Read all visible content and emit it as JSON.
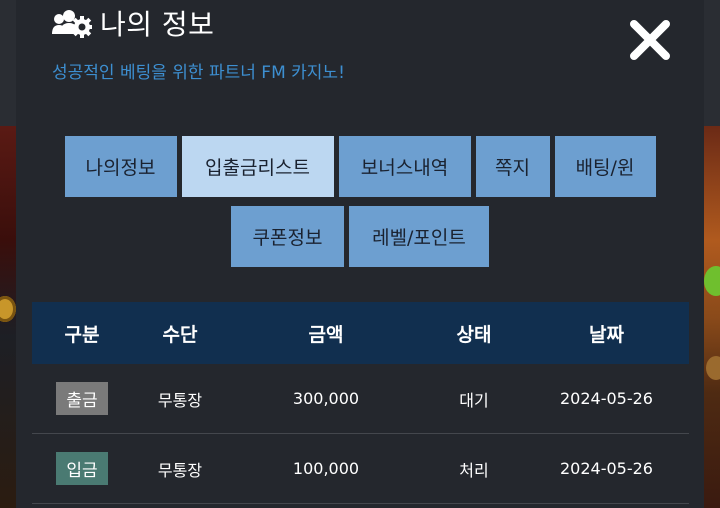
{
  "header": {
    "title": "나의 정보",
    "title_icon": "users-gear-icon",
    "subtitle": "성공적인 베팅을 위한 파트너 FM 카지노!",
    "close_icon": "close-icon"
  },
  "tabs": {
    "row1": [
      {
        "label": "나의정보",
        "active": false
      },
      {
        "label": "입출금리스트",
        "active": true
      },
      {
        "label": "보너스내역",
        "active": false
      },
      {
        "label": "쪽지",
        "active": false
      },
      {
        "label": "배팅/윈",
        "active": false
      }
    ],
    "row2": [
      {
        "label": "쿠폰정보",
        "active": false
      },
      {
        "label": "레벨/포인트",
        "active": false
      }
    ]
  },
  "table": {
    "headers": [
      "구분",
      "수단",
      "금액",
      "상태",
      "날짜"
    ],
    "rows": [
      {
        "type": "출금",
        "type_color": "#7a7a7a",
        "method": "무통장",
        "amount": "300,000",
        "status": "대기",
        "date": "2024-05-26"
      },
      {
        "type": "입금",
        "type_color": "#4a7a72",
        "method": "무통장",
        "amount": "100,000",
        "status": "처리",
        "date": "2024-05-26"
      }
    ]
  },
  "colors": {
    "accent": "#3d8fd1",
    "tab": "#6d9fd0",
    "tab_active": "#bcd7f1",
    "header_bg": "#112f4f",
    "modal_bg": "#24272d"
  }
}
